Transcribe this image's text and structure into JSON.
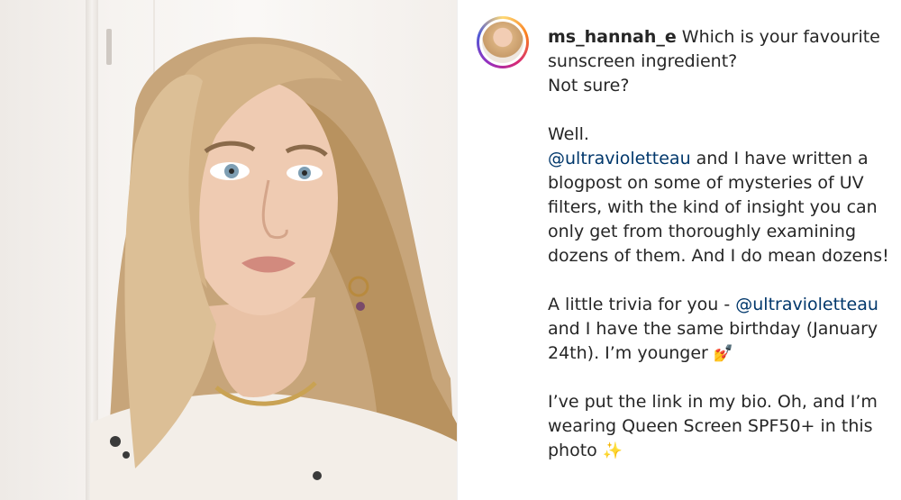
{
  "post": {
    "image_alt": "Portrait photo",
    "author": {
      "username": "ms_hannah_e"
    },
    "caption": {
      "intro": " Which is your favourite sunscreen ingredient?\nNot sure?\n\nWell.\n",
      "mention1": "@ultravioletteau",
      "part2": " and I have written a blogpost on some of mysteries of UV filters, with the kind of insight you can only get from thoroughly examining dozens of them. And I do mean dozens!\n\nA little trivia for you - ",
      "mention2": "@ultravioletteau",
      "part3": "\nand I have the same birthday (January 24th). I’m younger ",
      "emoji1": "💅",
      "part4": "\n\nI’ve put the link in my bio. Oh, and I’m wearing Queen Screen SPF50+ in this photo ",
      "emoji2": "✨"
    }
  }
}
